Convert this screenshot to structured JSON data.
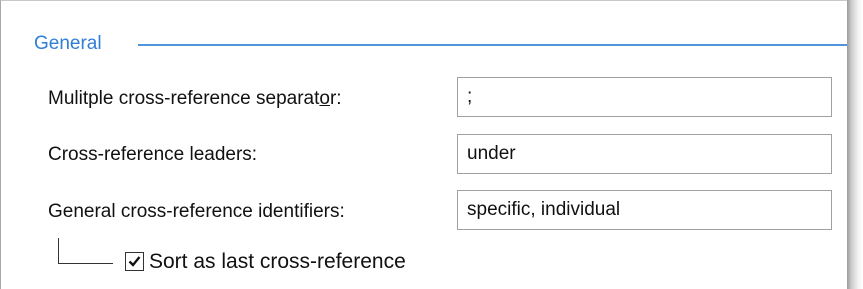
{
  "group": {
    "title": "General"
  },
  "fields": [
    {
      "label_pre": "Mulitple cross-reference separat",
      "label_mnemonic": "o",
      "label_post": "r:",
      "value": ";"
    },
    {
      "label": "Cross-reference leaders:",
      "value": "under"
    },
    {
      "label": "General cross-reference identifiers:",
      "value": "specific, individual"
    }
  ],
  "checkbox": {
    "label": "Sort as last cross-reference",
    "checked": true
  },
  "colors": {
    "group_title": "#2f7fd6",
    "group_rule": "#4f95dc"
  }
}
